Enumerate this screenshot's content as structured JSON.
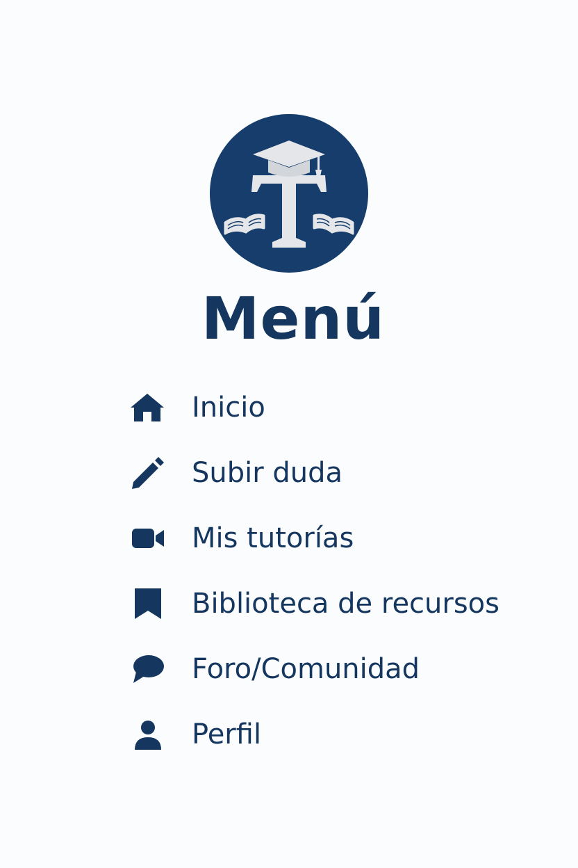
{
  "colors": {
    "primary": "#14365f",
    "logo_background": "#163d6b",
    "logo_emblem": "#e4e6ea",
    "background": "#fbfcfd"
  },
  "logo": {
    "letter": "T",
    "icon": "graduation-cap-with-books-logo"
  },
  "menu": {
    "title": "Menú",
    "items": [
      {
        "label": "Inicio",
        "icon": "home-icon"
      },
      {
        "label": "Subir duda",
        "icon": "pencil-icon"
      },
      {
        "label": "Mis tutorías",
        "icon": "video-camera-icon"
      },
      {
        "label": "Biblioteca de recursos",
        "icon": "bookmark-icon"
      },
      {
        "label": "Foro/Comunidad",
        "icon": "chat-bubble-icon"
      },
      {
        "label": "Perfil",
        "icon": "user-icon"
      }
    ]
  }
}
